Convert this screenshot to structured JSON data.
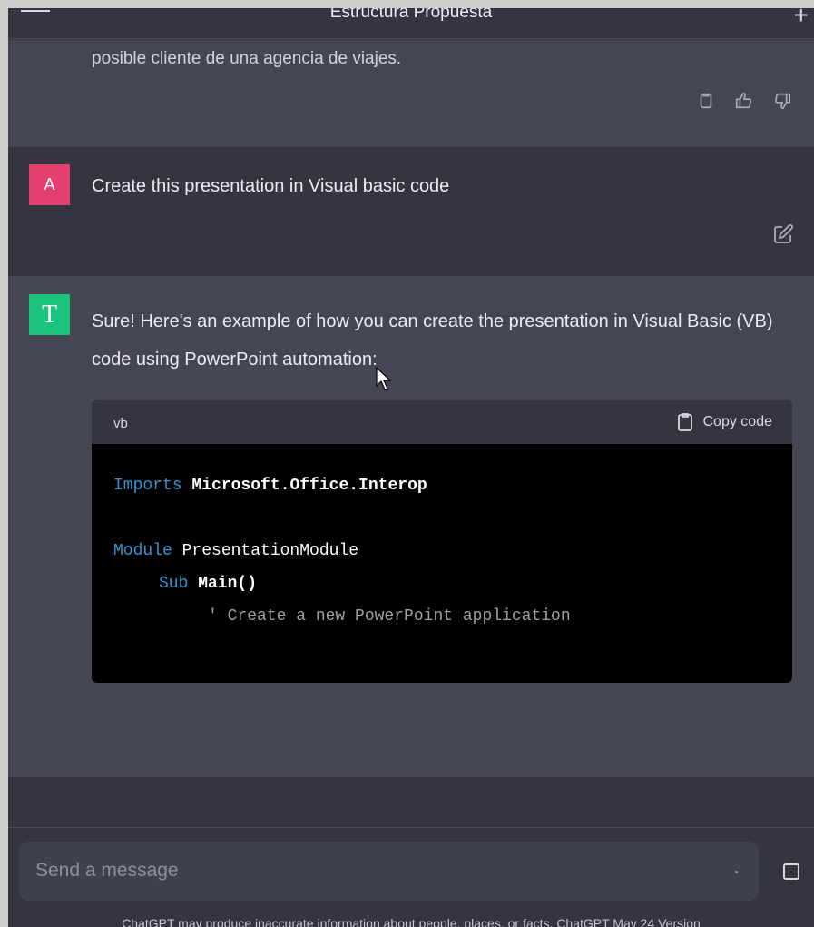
{
  "header": {
    "title": "Estructura Propuesta"
  },
  "previous_message": {
    "text": "posible cliente de una agencia de viajes."
  },
  "user_message": {
    "avatar_letter": "A",
    "text": "Create this presentation in Visual basic code"
  },
  "assistant_message": {
    "avatar_letter": "T",
    "text": "Sure! Here's an example of how you can create the presentation in Visual Basic (VB) code using PowerPoint automation:",
    "code_block": {
      "language": "vb",
      "copy_label": "Copy code",
      "lines": {
        "l1_kw": "Imports",
        "l1_rest": " Microsoft.Office.Interop",
        "l2_kw": "Module",
        "l2_rest": " PresentationModule",
        "l3_kw": "Sub",
        "l3_rest": " Main()",
        "l4_comment": "' Create a new PowerPoint application"
      }
    }
  },
  "composer": {
    "placeholder": "Send a message"
  },
  "footer": {
    "disclaimer": "ChatGPT may produce inaccurate information about people, places, or facts.",
    "version_link": "ChatGPT May 24 Version"
  },
  "colors": {
    "background": "#343541",
    "ai_background": "#444654",
    "user_avatar": "#e43f6f",
    "assistant_avatar": "#19c37d",
    "keyword": "#2e95d3"
  }
}
